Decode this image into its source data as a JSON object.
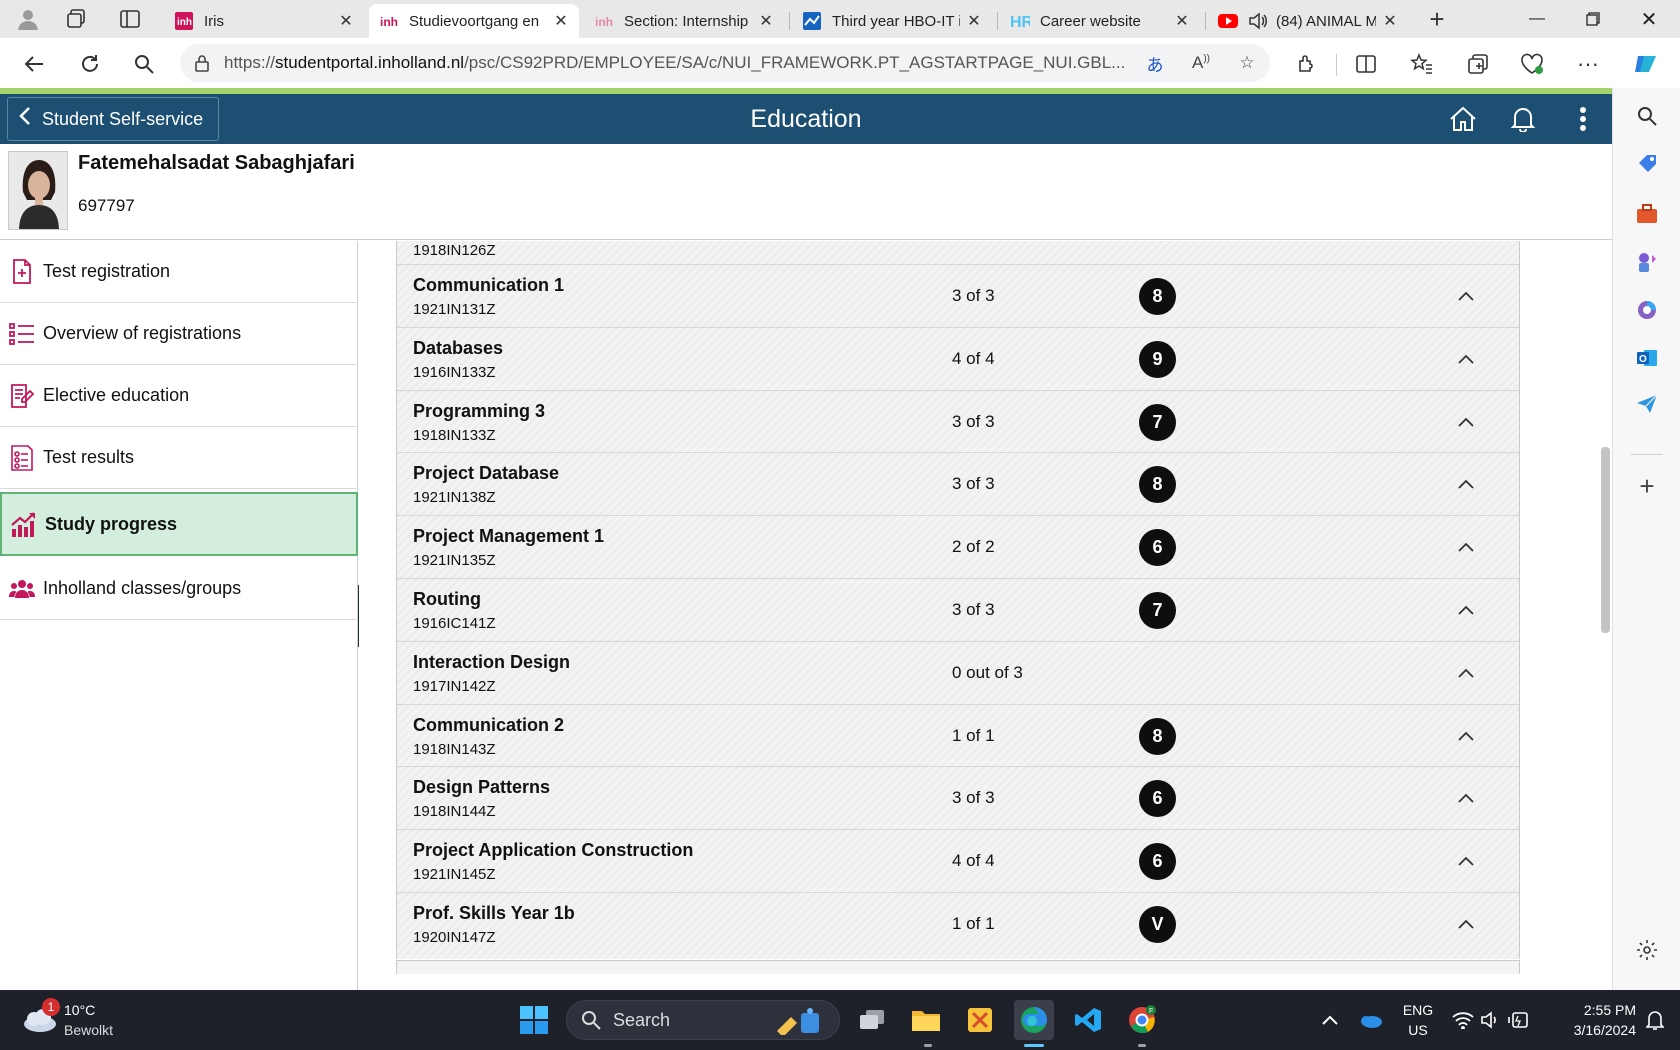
{
  "browser": {
    "tabs": [
      {
        "title": "Iris",
        "active": false
      },
      {
        "title": "Studievoortgang en",
        "active": true
      },
      {
        "title": "Section: Internship",
        "active": false
      },
      {
        "title": "Third year HBO-IT i",
        "active": false
      },
      {
        "title": "Career website",
        "active": false
      },
      {
        "title": "(84) ANIMAL M",
        "active": false
      }
    ],
    "url_prefix": "https://",
    "url_host": "studentportal.inholland.nl",
    "url_path": "/psc/CS92PRD/EMPLOYEE/SA/c/NUI_FRAMEWORK.PT_AGSTARTPAGE_NUI.GBL...",
    "accent_color": "#0078d4"
  },
  "app": {
    "back_label": "Student Self-service",
    "title": "Education",
    "header_color": "#1c4f72"
  },
  "profile": {
    "name": "Fatemehalsadat Sabaghjafari",
    "student_id": "697797"
  },
  "nav": {
    "items": [
      {
        "label": "Test registration",
        "icon": "document-plus-icon",
        "selected": false
      },
      {
        "label": "Overview of registrations",
        "icon": "list-icon",
        "selected": false
      },
      {
        "label": "Elective education",
        "icon": "document-edit-icon",
        "selected": false
      },
      {
        "label": "Test results",
        "icon": "checklist-icon",
        "selected": false
      },
      {
        "label": "Study progress",
        "icon": "chart-up-icon",
        "selected": true
      },
      {
        "label": "Inholland classes/groups",
        "icon": "group-icon",
        "selected": false
      }
    ],
    "icon_color": "#c2185b",
    "selected_color": "#d4eedd"
  },
  "courses": {
    "partial_top_code": "1918IN126Z",
    "rows": [
      {
        "name": "Communication 1",
        "code": "1921IN131Z",
        "progress": "3 of 3",
        "grade": "8"
      },
      {
        "name": "Databases",
        "code": "1916IN133Z",
        "progress": "4 of 4",
        "grade": "9"
      },
      {
        "name": "Programming 3",
        "code": "1918IN133Z",
        "progress": "3 of 3",
        "grade": "7"
      },
      {
        "name": "Project Database",
        "code": "1921IN138Z",
        "progress": "3 of 3",
        "grade": "8"
      },
      {
        "name": "Project Management 1",
        "code": "1921IN135Z",
        "progress": "2 of 2",
        "grade": "6"
      },
      {
        "name": "Routing",
        "code": "1916IC141Z",
        "progress": "3 of 3",
        "grade": "7"
      },
      {
        "name": "Interaction Design",
        "code": "1917IN142Z",
        "progress": "0 out of 3",
        "grade": ""
      },
      {
        "name": "Communication 2",
        "code": "1918IN143Z",
        "progress": "1 of 1",
        "grade": "8"
      },
      {
        "name": "Design Patterns",
        "code": "1918IN144Z",
        "progress": "3 of 3",
        "grade": "6"
      },
      {
        "name": "Project Application Construction",
        "code": "1921IN145Z",
        "progress": "4 of 4",
        "grade": "6"
      },
      {
        "name": "Prof. Skills Year 1b",
        "code": "1920IN147Z",
        "progress": "1 of 1",
        "grade": "V"
      }
    ]
  },
  "taskbar": {
    "weather_badge": "1",
    "temperature": "10°C",
    "condition": "Bewolkt",
    "search_placeholder": "Search",
    "lang_line1": "ENG",
    "lang_line2": "US",
    "time": "2:55 PM",
    "date": "3/16/2024"
  }
}
